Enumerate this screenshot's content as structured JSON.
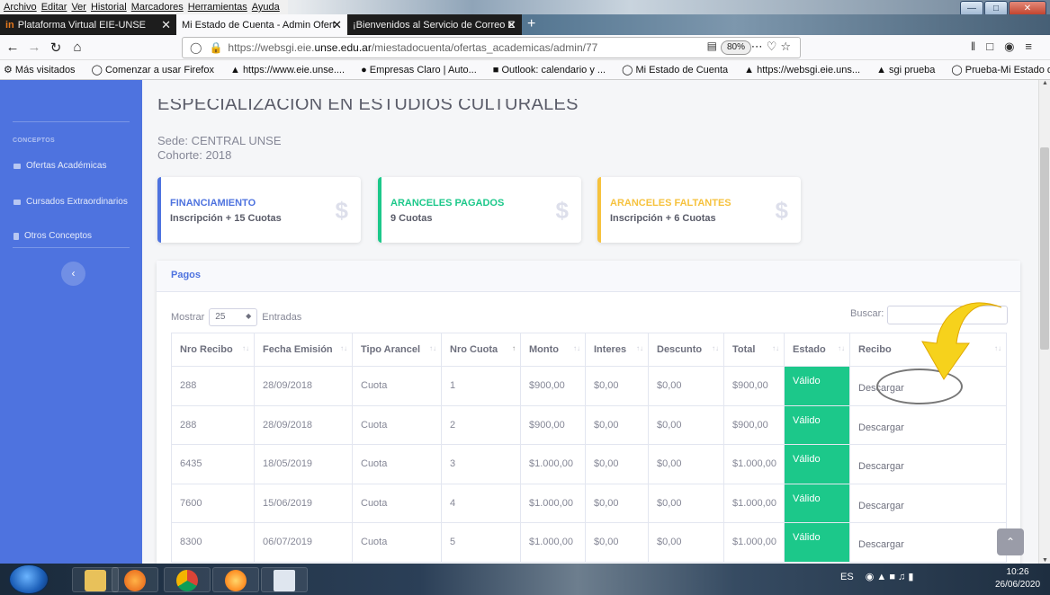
{
  "menubar": {
    "items": [
      "Archivo",
      "Editar",
      "Ver",
      "Historial",
      "Marcadores",
      "Herramientas",
      "Ayuda"
    ]
  },
  "tabs": [
    {
      "label": "Plataforma Virtual EIE-UNSE"
    },
    {
      "label": "Mi Estado de Cuenta - Admin Ofert"
    },
    {
      "label": "¡Bienvenidos al Servicio de Correo E"
    }
  ],
  "url": {
    "prefix": "https://websgi.eie.",
    "host": "unse.edu.ar",
    "path": "/miestadocuenta/ofertas_academicas/admin/77",
    "zoom": "80%"
  },
  "bookmarks": [
    "Más visitados",
    "Comenzar a usar Firefox",
    "https://www.eie.unse....",
    "Empresas Claro | Auto...",
    "Outlook: calendario y ...",
    "Mi Estado de Cuenta",
    "https://websgi.eie.uns...",
    "sgi prueba",
    "Prueba-Mi Estado de ..."
  ],
  "sidebar": {
    "heading": "CONCEPTOS",
    "items": [
      "Ofertas Académicas",
      "Cursados Extraordinarios",
      "Otros Conceptos"
    ]
  },
  "page": {
    "title": "ESPECIALIZACION EN ESTUDIOS CULTURALES",
    "sede": "Sede: CENTRAL UNSE",
    "cohorte": "Cohorte: 2018"
  },
  "cards": [
    {
      "label": "FINANCIAMIENTO",
      "value": "Inscripción + 15 Cuotas",
      "color": "#4e73df"
    },
    {
      "label": "ARANCELES PAGADOS",
      "value": "9 Cuotas",
      "color": "#1cc88a"
    },
    {
      "label": "ARANCELES FALTANTES",
      "value": "Inscripción + 6 Cuotas",
      "color": "#f6c23e"
    }
  ],
  "pagos": {
    "title": "Pagos",
    "mostrar": "Mostrar",
    "page_size": "25",
    "entradas": "Entradas",
    "buscar": "Buscar:",
    "columns": [
      "Nro Recibo",
      "Fecha Emisión",
      "Tipo Arancel",
      "Nro Cuota",
      "Monto",
      "Interes",
      "Descunto",
      "Total",
      "Estado",
      "Recibo"
    ],
    "rows": [
      [
        "288",
        "28/09/2018",
        "Cuota",
        "1",
        "$900,00",
        "$0,00",
        "$0,00",
        "$900,00",
        "Válido",
        "Descargar"
      ],
      [
        "288",
        "28/09/2018",
        "Cuota",
        "2",
        "$900,00",
        "$0,00",
        "$0,00",
        "$900,00",
        "Válido",
        "Descargar"
      ],
      [
        "6435",
        "18/05/2019",
        "Cuota",
        "3",
        "$1.000,00",
        "$0,00",
        "$0,00",
        "$1.000,00",
        "Válido",
        "Descargar"
      ],
      [
        "7600",
        "15/06/2019",
        "Cuota",
        "4",
        "$1.000,00",
        "$0,00",
        "$0,00",
        "$1.000,00",
        "Válido",
        "Descargar"
      ],
      [
        "8300",
        "06/07/2019",
        "Cuota",
        "5",
        "$1.000,00",
        "$0,00",
        "$0,00",
        "$1.000,00",
        "Válido",
        "Descargar"
      ]
    ]
  },
  "taskbar": {
    "lang": "ES",
    "time": "10:26",
    "date": "26/06/2020"
  }
}
